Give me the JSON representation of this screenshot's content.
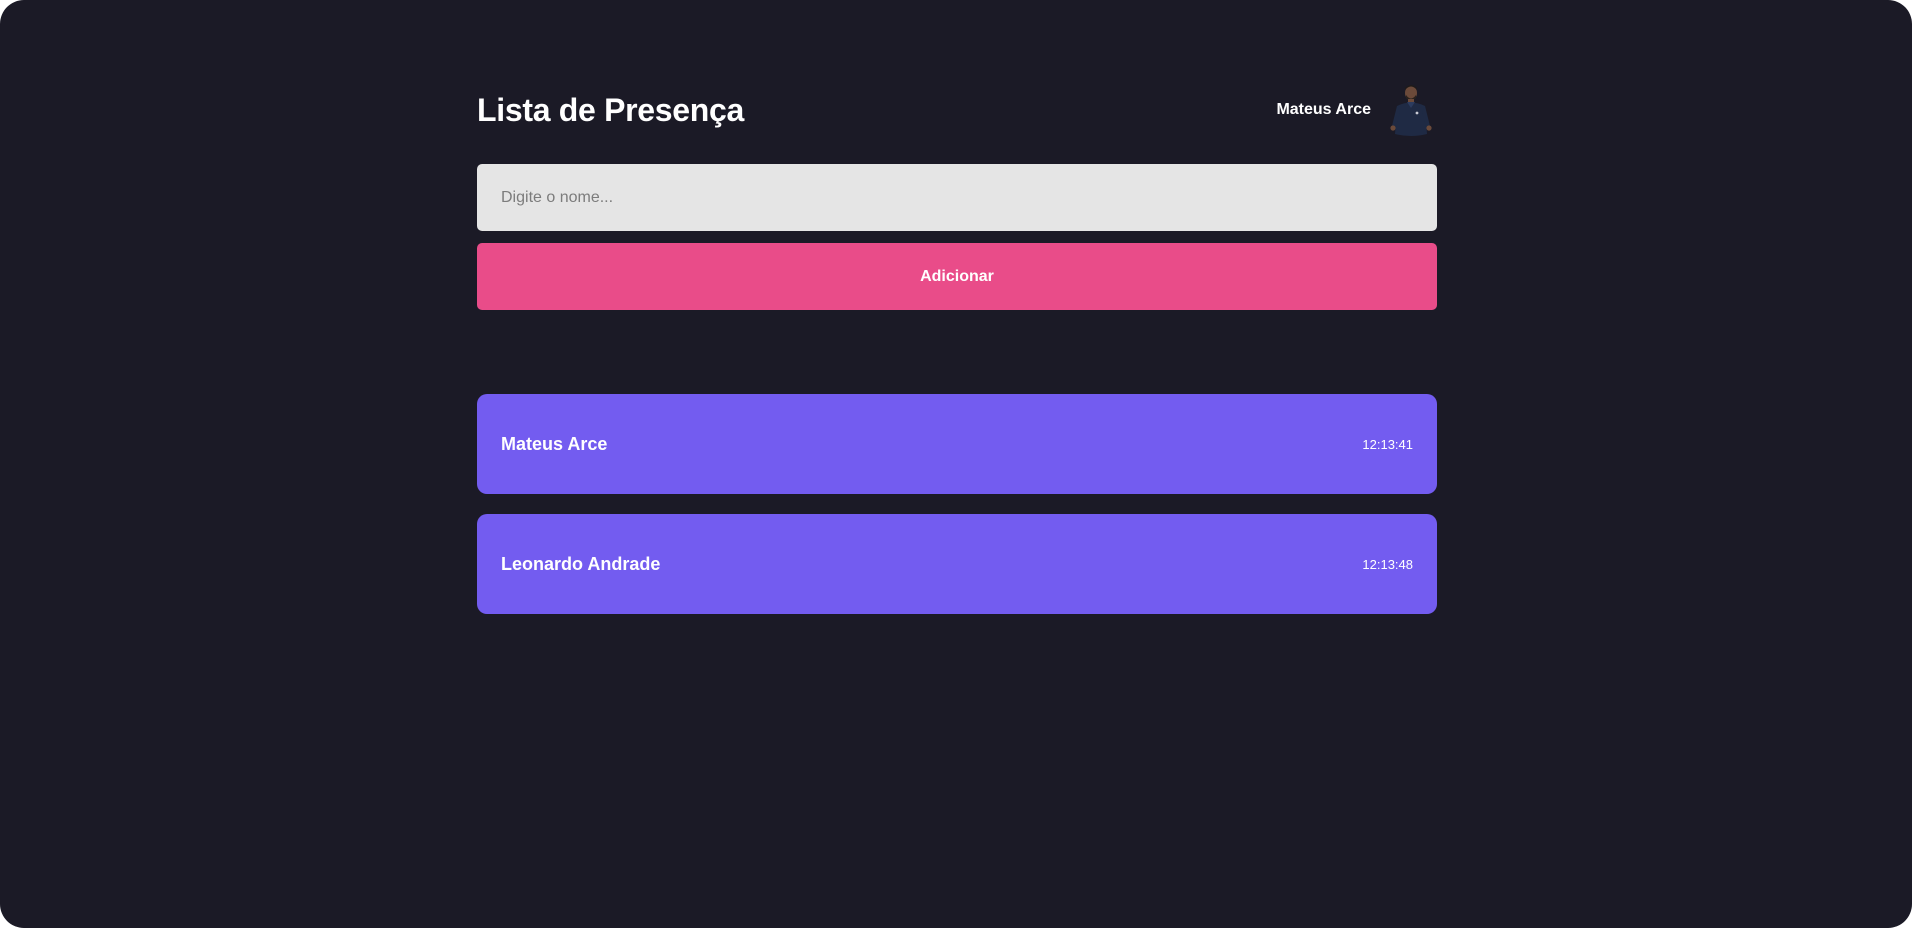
{
  "page": {
    "title": "Lista de Presença"
  },
  "user": {
    "name": "Mateus Arce",
    "avatar_icon": "user-avatar-icon"
  },
  "form": {
    "input_placeholder": "Digite o nome...",
    "input_value": "",
    "add_label": "Adicionar"
  },
  "attendees": [
    {
      "name": "Mateus Arce",
      "time": "12:13:41"
    },
    {
      "name": "Leonardo Andrade",
      "time": "12:13:48"
    }
  ],
  "colors": {
    "background": "#1b1a26",
    "input_bg": "#e5e5e5",
    "button_bg": "#e94c89",
    "card_bg": "#735cf0",
    "text": "#ffffff"
  }
}
